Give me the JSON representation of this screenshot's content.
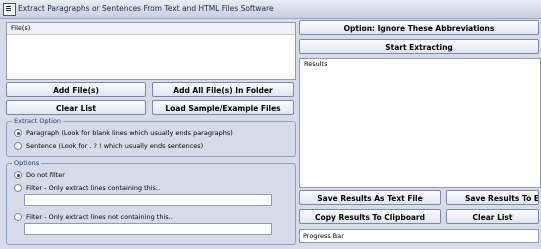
{
  "window": {
    "title": "Extract Paragraphs or Sentences From Text and HTML Files Software"
  },
  "files": {
    "header": "File(s)"
  },
  "buttons": {
    "add_files": "Add File(s)",
    "add_folder": "Add All File(s) In Folder",
    "clear_list": "Clear List",
    "load_sample": "Load Sample/Example Files",
    "option_ignore": "Option: Ignore These Abbreviations",
    "start": "Start Extracting",
    "save_text": "Save Results As Text File",
    "save_excel": "Save Results To Excel",
    "copy_clipboard": "Copy Results To Clipboard",
    "clear_results": "Clear List"
  },
  "extract_option": {
    "legend": "Extract Option",
    "paragraph": "Paragraph (Look for blank lines which usually ends paragraphs)",
    "sentence": "Sentence (Look for . ? ! which usually ends sentences)",
    "selected": "paragraph"
  },
  "options": {
    "legend": "Options",
    "do_not_filter": "Do not filter",
    "filter_containing": "Filter - Only extract lines containing this..",
    "filter_not_containing": "Filter - Only extract lines not containing this..",
    "selected": "do_not_filter",
    "containing_value": "",
    "not_containing_value": ""
  },
  "results": {
    "header": "Results"
  },
  "progress": {
    "label": "Progress Bar",
    "value": 0
  }
}
